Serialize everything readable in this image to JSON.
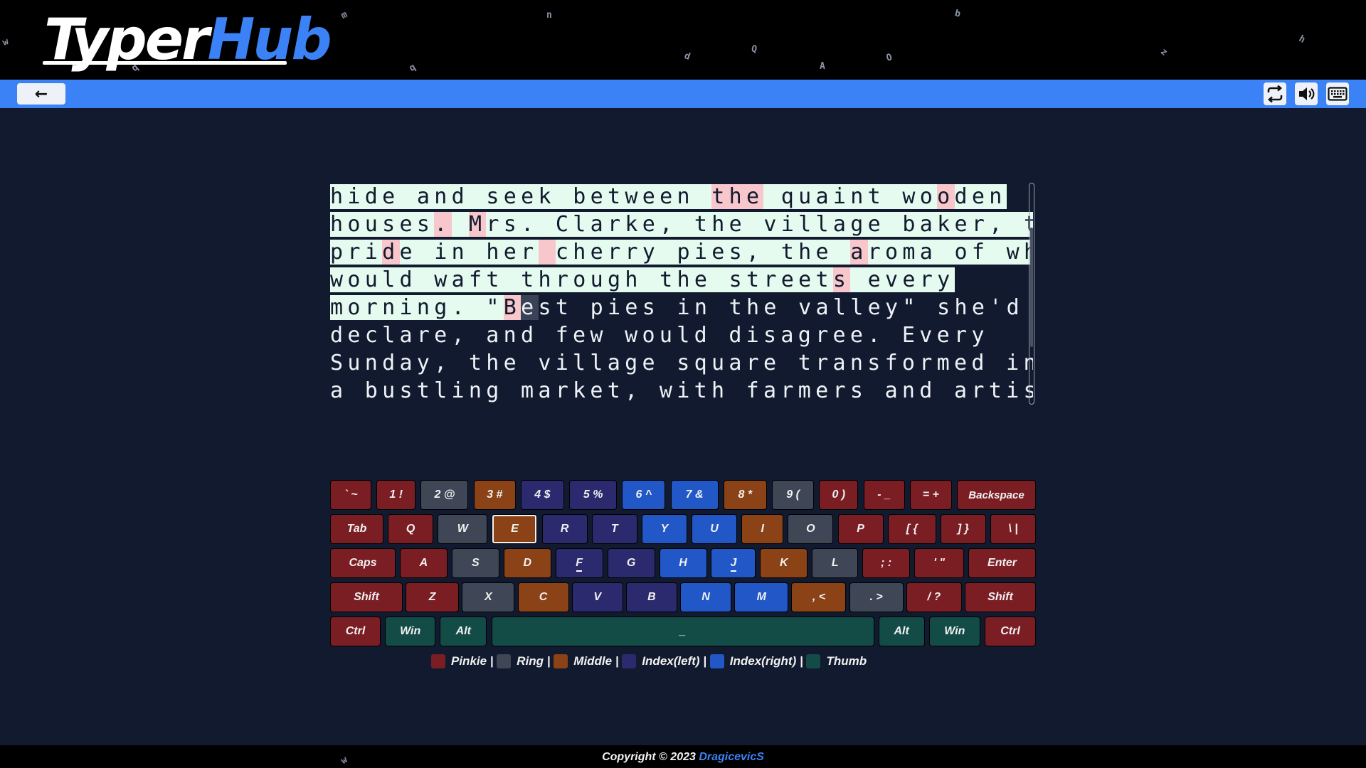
{
  "app": {
    "logo_part1": "Typer",
    "logo_part2": "Hub",
    "brand_color": "#3b82f6",
    "floating_letters": [
      "m",
      "n",
      "b",
      "w",
      "h",
      "q",
      "d",
      "Q",
      "A",
      "O",
      "z",
      "q",
      "w"
    ]
  },
  "toolbar": {
    "back_label": "←",
    "icons": [
      "repeat-icon",
      "volume-icon",
      "keyboard-icon"
    ]
  },
  "typing": {
    "lines": [
      "hide and seek between the quaint wooden",
      "houses. Mrs. Clarke, the village baker, took",
      "pride in her cherry pies, the aroma of which",
      "would waft through the streets every",
      "morning. \"Best pies in the valley\" she'd",
      "declare, and few would disagree. Every",
      "Sunday, the village square transformed into",
      "a bustling market, with farmers and artisans"
    ],
    "typed_upto": {
      "line": 4,
      "col": 11
    },
    "cursor": {
      "line": 4,
      "col": 11
    },
    "errors": [
      [
        0,
        22
      ],
      [
        0,
        23
      ],
      [
        0,
        24
      ],
      [
        0,
        35
      ],
      [
        1,
        6
      ],
      [
        1,
        8
      ],
      [
        2,
        3
      ],
      [
        2,
        12
      ],
      [
        2,
        30
      ],
      [
        3,
        29
      ],
      [
        4,
        10
      ]
    ]
  },
  "keyboard": {
    "active_key": "E",
    "legend": [
      {
        "label": "Pinkie |",
        "color": "#7a1e24"
      },
      {
        "label": "Ring |",
        "color": "#3f4756"
      },
      {
        "label": "Middle |",
        "color": "#8a4216"
      },
      {
        "label": "Index(left) |",
        "color": "#2c2a6e"
      },
      {
        "label": "Index(right) |",
        "color": "#2157c7"
      },
      {
        "label": "Thumb",
        "color": "#134c47"
      }
    ],
    "rows": [
      [
        {
          "label": "` ~",
          "finger": "pinkie"
        },
        {
          "label": "1 !",
          "finger": "pinkie"
        },
        {
          "label": "2 @",
          "finger": "ring"
        },
        {
          "label": "3 #",
          "finger": "middle"
        },
        {
          "label": "4 $",
          "finger": "ileft"
        },
        {
          "label": "5 %",
          "finger": "ileft"
        },
        {
          "label": "6 ^",
          "finger": "iright"
        },
        {
          "label": "7 &",
          "finger": "iright"
        },
        {
          "label": "8 *",
          "finger": "middle"
        },
        {
          "label": "9 (",
          "finger": "ring"
        },
        {
          "label": "0 )",
          "finger": "pinkie"
        },
        {
          "label": "- _",
          "finger": "pinkie"
        },
        {
          "label": "= +",
          "finger": "pinkie"
        },
        {
          "label": "Backspace",
          "finger": "pinkie"
        }
      ],
      [
        {
          "label": "Tab",
          "finger": "pinkie"
        },
        {
          "label": "Q",
          "finger": "pinkie"
        },
        {
          "label": "W",
          "finger": "ring"
        },
        {
          "label": "E",
          "finger": "middle"
        },
        {
          "label": "R",
          "finger": "ileft"
        },
        {
          "label": "T",
          "finger": "ileft"
        },
        {
          "label": "Y",
          "finger": "iright"
        },
        {
          "label": "U",
          "finger": "iright"
        },
        {
          "label": "I",
          "finger": "middle"
        },
        {
          "label": "O",
          "finger": "ring"
        },
        {
          "label": "P",
          "finger": "pinkie"
        },
        {
          "label": "[ {",
          "finger": "pinkie"
        },
        {
          "label": "] }",
          "finger": "pinkie"
        },
        {
          "label": "\\ |",
          "finger": "pinkie"
        }
      ],
      [
        {
          "label": "Caps",
          "finger": "pinkie"
        },
        {
          "label": "A",
          "finger": "pinkie"
        },
        {
          "label": "S",
          "finger": "ring"
        },
        {
          "label": "D",
          "finger": "middle"
        },
        {
          "label": "F",
          "finger": "ileft"
        },
        {
          "label": "G",
          "finger": "ileft"
        },
        {
          "label": "H",
          "finger": "iright"
        },
        {
          "label": "J",
          "finger": "iright"
        },
        {
          "label": "K",
          "finger": "middle"
        },
        {
          "label": "L",
          "finger": "ring"
        },
        {
          "label": "; :",
          "finger": "pinkie"
        },
        {
          "label": "' \"",
          "finger": "pinkie"
        },
        {
          "label": "Enter",
          "finger": "pinkie"
        }
      ],
      [
        {
          "label": "Shift",
          "finger": "pinkie"
        },
        {
          "label": "Z",
          "finger": "pinkie"
        },
        {
          "label": "X",
          "finger": "ring"
        },
        {
          "label": "C",
          "finger": "middle"
        },
        {
          "label": "V",
          "finger": "ileft"
        },
        {
          "label": "B",
          "finger": "ileft"
        },
        {
          "label": "N",
          "finger": "iright"
        },
        {
          "label": "M",
          "finger": "iright"
        },
        {
          "label": ", <",
          "finger": "middle"
        },
        {
          "label": ". >",
          "finger": "ring"
        },
        {
          "label": "/ ?",
          "finger": "pinkie"
        },
        {
          "label": "Shift",
          "finger": "pinkie"
        }
      ],
      [
        {
          "label": "Ctrl",
          "finger": "pinkie"
        },
        {
          "label": "Win",
          "finger": "thumb"
        },
        {
          "label": "Alt",
          "finger": "thumb"
        },
        {
          "label": "_",
          "finger": "thumb"
        },
        {
          "label": "Alt",
          "finger": "thumb"
        },
        {
          "label": "Win",
          "finger": "thumb"
        },
        {
          "label": "Ctrl",
          "finger": "pinkie"
        }
      ]
    ]
  },
  "footer": {
    "copyright": "Copyright © 2023 ",
    "author": "DragicevicS"
  }
}
